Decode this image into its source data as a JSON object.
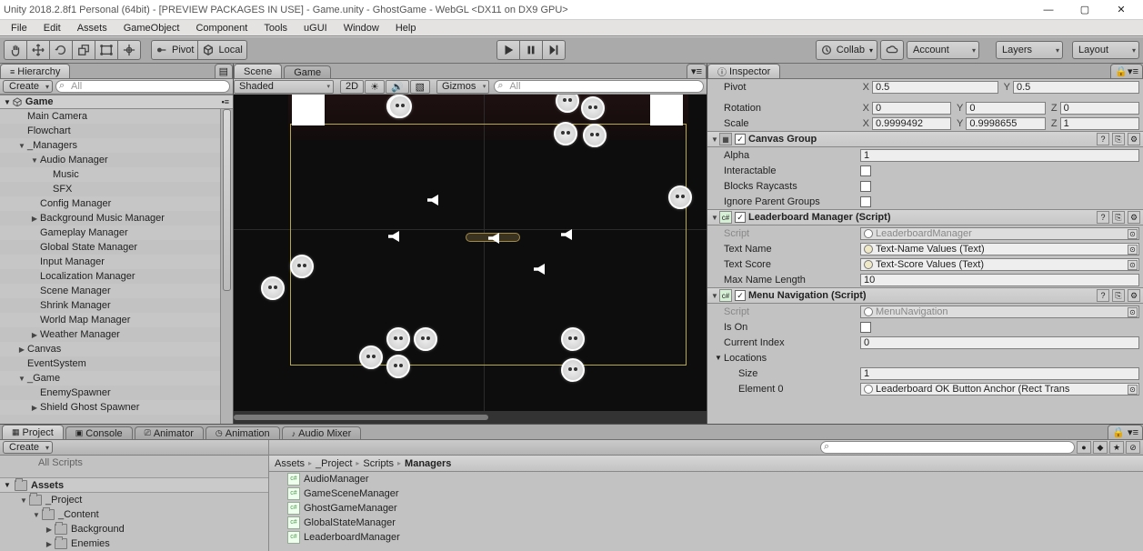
{
  "window": {
    "title": "Unity 2018.2.8f1 Personal (64bit) - [PREVIEW PACKAGES IN USE] - Game.unity - GhostGame - WebGL <DX11 on DX9 GPU>",
    "min": "—",
    "max": "▢",
    "close": "✕"
  },
  "menu": {
    "items": [
      "File",
      "Edit",
      "Assets",
      "GameObject",
      "Component",
      "Tools",
      "uGUI",
      "Window",
      "Help"
    ]
  },
  "toolbar": {
    "pivot": "Pivot",
    "local": "Local",
    "collab": "Collab",
    "account": "Account",
    "layers": "Layers",
    "layout": "Layout"
  },
  "hierarchy": {
    "tab": "Hierarchy",
    "create": "Create",
    "searchPH": "All",
    "scene": "Game",
    "rows": [
      {
        "l": 1,
        "tw": "",
        "t": "Main Camera"
      },
      {
        "l": 1,
        "tw": "",
        "t": "Flowchart"
      },
      {
        "l": 1,
        "tw": "▼",
        "t": "_Managers"
      },
      {
        "l": 2,
        "tw": "▼",
        "t": "Audio Manager"
      },
      {
        "l": 3,
        "tw": "",
        "t": "Music"
      },
      {
        "l": 3,
        "tw": "",
        "t": "SFX"
      },
      {
        "l": 2,
        "tw": "",
        "t": "Config Manager"
      },
      {
        "l": 2,
        "tw": "▶",
        "t": "Background Music Manager"
      },
      {
        "l": 2,
        "tw": "",
        "t": "Gameplay Manager"
      },
      {
        "l": 2,
        "tw": "",
        "t": "Global State Manager"
      },
      {
        "l": 2,
        "tw": "",
        "t": "Input Manager"
      },
      {
        "l": 2,
        "tw": "",
        "t": "Localization Manager"
      },
      {
        "l": 2,
        "tw": "",
        "t": "Scene Manager"
      },
      {
        "l": 2,
        "tw": "",
        "t": "Shrink Manager"
      },
      {
        "l": 2,
        "tw": "",
        "t": "World Map Manager"
      },
      {
        "l": 2,
        "tw": "▶",
        "t": "Weather Manager"
      },
      {
        "l": 1,
        "tw": "▶",
        "t": "Canvas"
      },
      {
        "l": 1,
        "tw": "",
        "t": "EventSystem"
      },
      {
        "l": 1,
        "tw": "▼",
        "t": "_Game"
      },
      {
        "l": 2,
        "tw": "",
        "t": "EnemySpawner"
      },
      {
        "l": 2,
        "tw": "▶",
        "t": "Shield Ghost Spawner"
      }
    ]
  },
  "scene": {
    "tabScene": "Scene",
    "tabGame": "Game",
    "shaded": "Shaded",
    "twod": "2D",
    "gizmos": "Gizmos",
    "searchPH": "All"
  },
  "inspector": {
    "tab": "Inspector",
    "pivot": {
      "lbl": "Pivot",
      "x": "0.5",
      "y": "0.5"
    },
    "rotation": {
      "lbl": "Rotation",
      "x": "0",
      "y": "0",
      "z": "0"
    },
    "scale": {
      "lbl": "Scale",
      "x": "0.9999492",
      "y": "0.9998655",
      "z": "1"
    },
    "canvasGroup": {
      "title": "Canvas Group",
      "alphaL": "Alpha",
      "alpha": "1",
      "interactL": "Interactable",
      "blocksL": "Blocks Raycasts",
      "ignoreL": "Ignore Parent Groups"
    },
    "leaderboard": {
      "title": "Leaderboard Manager (Script)",
      "scriptL": "Script",
      "scriptV": "LeaderboardManager",
      "tnameL": "Text Name",
      "tnameV": "Text-Name Values (Text)",
      "tscoreL": "Text Score",
      "tscoreV": "Text-Score Values (Text)",
      "maxL": "Max Name Length",
      "maxV": "10"
    },
    "menuNav": {
      "title": "Menu Navigation (Script)",
      "scriptL": "Script",
      "scriptV": "MenuNavigation",
      "isonL": "Is On",
      "curL": "Current Index",
      "curV": "0",
      "locL": "Locations",
      "sizeL": "Size",
      "sizeV": "1",
      "el0L": "Element 0",
      "el0V": "Leaderboard OK Button Anchor (Rect Trans"
    }
  },
  "project": {
    "tabs": [
      "Project",
      "Console",
      "Animator",
      "Animation",
      "Audio Mixer"
    ],
    "create": "Create",
    "searchPH": "",
    "leftTop": "All Scripts",
    "assetsHeader": "Assets",
    "left": [
      {
        "l": 0,
        "tw": "▼",
        "t": "_Project"
      },
      {
        "l": 1,
        "tw": "▼",
        "t": "_Content"
      },
      {
        "l": 2,
        "tw": "▶",
        "t": "Background"
      },
      {
        "l": 2,
        "tw": "▶",
        "t": "Enemies"
      }
    ],
    "breadcrumb": [
      "Assets",
      "_Project",
      "Scripts",
      "Managers"
    ],
    "assets": [
      "AudioManager",
      "GameSceneManager",
      "GhostGameManager",
      "GlobalStateManager",
      "LeaderboardManager"
    ]
  }
}
